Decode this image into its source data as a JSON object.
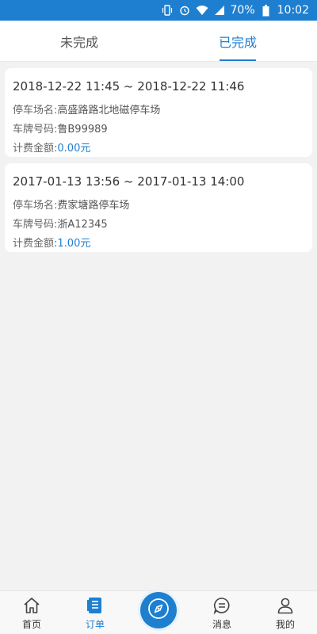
{
  "status_bar": {
    "battery": "70%",
    "time": "10:02",
    "icons": [
      "vibrate-icon",
      "alarm-icon",
      "wifi-icon",
      "signal-icon",
      "battery-icon"
    ]
  },
  "tabs": [
    {
      "label": "未完成",
      "active": false
    },
    {
      "label": "已完成",
      "active": true
    }
  ],
  "orders": [
    {
      "time_range": "2018-12-22 11:45 ~ 2018-12-22 11:46",
      "lot_label": "停车场名:",
      "lot_value": "高盛路路北地磁停车场",
      "plate_label": "车牌号码:",
      "plate_value": "鲁B99989",
      "fee_label": "计费金额:",
      "fee_value": "0.00元"
    },
    {
      "time_range": "2017-01-13 13:56 ~ 2017-01-13 14:00",
      "lot_label": "停车场名:",
      "lot_value": "费家塘路停车场",
      "plate_label": "车牌号码:",
      "plate_value": "浙A12345",
      "fee_label": "计费金额:",
      "fee_value": "1.00元"
    }
  ],
  "bottom_nav": {
    "home": "首页",
    "orders": "订单",
    "center_icon": "compass-icon",
    "messages": "消息",
    "mine": "我的"
  },
  "colors": {
    "accent": "#1e7fd0",
    "background": "#f2f2f2"
  }
}
